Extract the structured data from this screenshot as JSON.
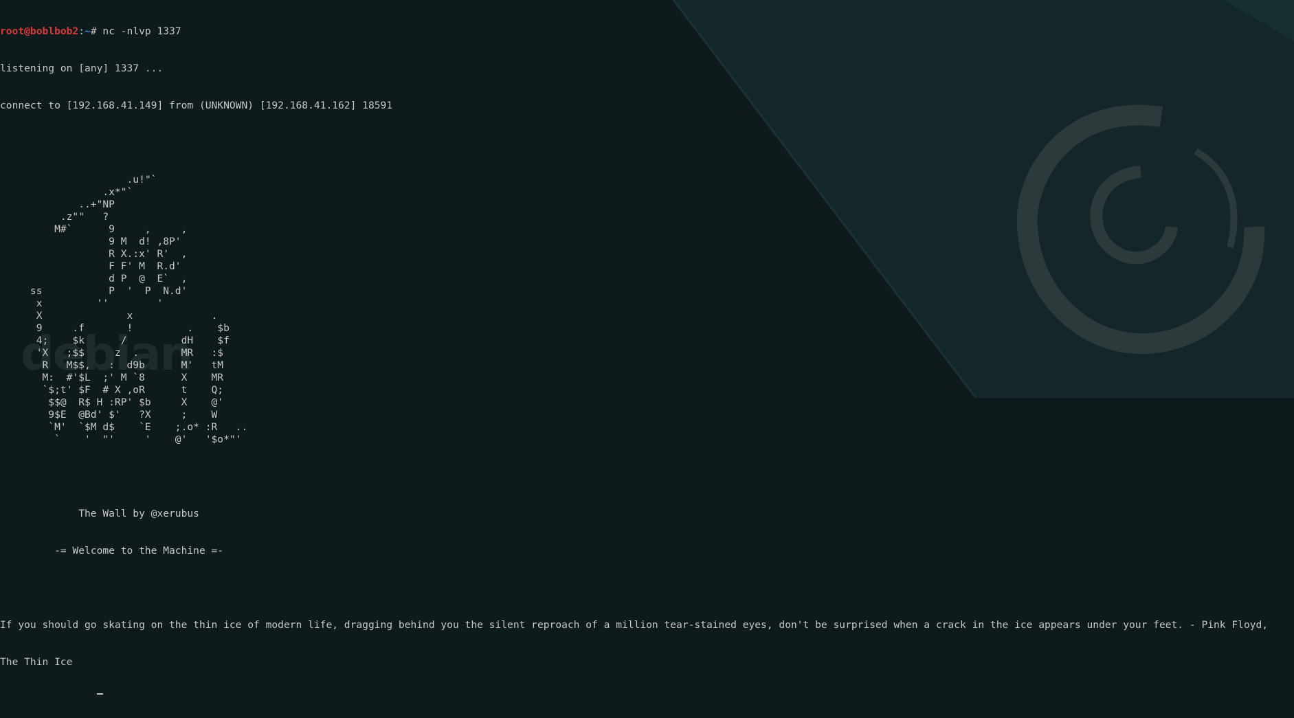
{
  "wallpaper": {
    "logo_text": "debian",
    "colors": {
      "background": "#0e1a1b",
      "panel_light": "#16282a",
      "swirl": "#2c3a3b",
      "logo_text": "#1f2c2d"
    }
  },
  "terminal": {
    "colors": {
      "text": "#c8c8c8",
      "prompt_user": "#d83a3a",
      "prompt_path": "#3f7fd6"
    },
    "prompt": {
      "user_host": "root@boblbob2",
      "separator": ":",
      "path": "~",
      "symbol": "# ",
      "command": "nc -nlvp 1337"
    },
    "output": [
      "listening on [any] 1337 ...",
      "connect to [192.168.41.149] from (UNKNOWN) [192.168.41.162] 18591"
    ],
    "ascii_art": [
      "                     .u!\"`",
      "                 .x*\"`",
      "             ..+\"NP",
      "          .z\"\"   ?",
      "         M#`      9     ,     ,",
      "                  9 M  d! ,8P'",
      "                  R X.:x' R'  ,",
      "                  F F' M  R.d'",
      "                  d P  @  E`  ,",
      "     ss           P  '  P  N.d'",
      "      x         ''        '",
      "      X              x             .",
      "      9     .f       !         .    $b",
      "      4;    $k      /         dH    $f",
      "      'X   ;$$     z  .       MR   :$",
      "       R   M$$,   :  d9b      M'   tM",
      "       M:  #'$L  ;' M `8      X    MR",
      "       `$;t' $F  # X ,oR      t    Q;",
      "        $$@  R$ H :RP' $b     X    @'",
      "        9$E  @Bd' $'   ?X     ;    W",
      "        `M'  `$M d$    `E    ;.o* :R   ..",
      "         `    '  \"'     '    @'   '$o*\"'"
    ],
    "banner": {
      "line1": "             The Wall by @xerubus",
      "line2": "         -= Welcome to the Machine =-"
    },
    "message_line1": "If you should go skating on the thin ice of modern life, dragging behind you the silent reproach of a million tear-stained eyes, don't be surprised when a crack in the ice appears under your feet. - Pink Floyd,",
    "message_line2": "The Thin Ice",
    "cursor_indent": "                "
  }
}
